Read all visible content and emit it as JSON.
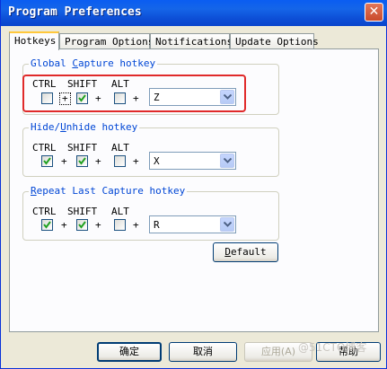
{
  "window": {
    "title": "Program Preferences"
  },
  "tabs": [
    {
      "label": "Hotkeys",
      "active": true
    },
    {
      "label": "Program Options",
      "active": false
    },
    {
      "label": "Notifications",
      "active": false
    },
    {
      "label": "Update Options",
      "active": false
    }
  ],
  "modifiers": {
    "ctrl": "CTRL",
    "shift": "SHIFT",
    "alt": "ALT",
    "plus": "+"
  },
  "groups": [
    {
      "label_pre": "Global ",
      "label_key": "C",
      "label_post": "apture hotkey",
      "ctrl": false,
      "shift": true,
      "alt": false,
      "key": "Z"
    },
    {
      "label_pre": "Hide/",
      "label_key": "U",
      "label_post": "nhide hotkey",
      "ctrl": true,
      "shift": true,
      "alt": false,
      "key": "X"
    },
    {
      "label_pre": "",
      "label_key": "R",
      "label_post": "epeat Last Capture hotkey",
      "ctrl": true,
      "shift": true,
      "alt": false,
      "key": "R"
    }
  ],
  "default_button": {
    "key": "D",
    "rest": "efault"
  },
  "footer": {
    "ok": "确定",
    "cancel": "取消",
    "apply": "应用(A)",
    "help": "帮助"
  },
  "watermark": "@51CTO博客",
  "colors": {
    "accent": "#0046d5",
    "highlight": "#e02a2a",
    "title_bar": "#0a5df2"
  }
}
